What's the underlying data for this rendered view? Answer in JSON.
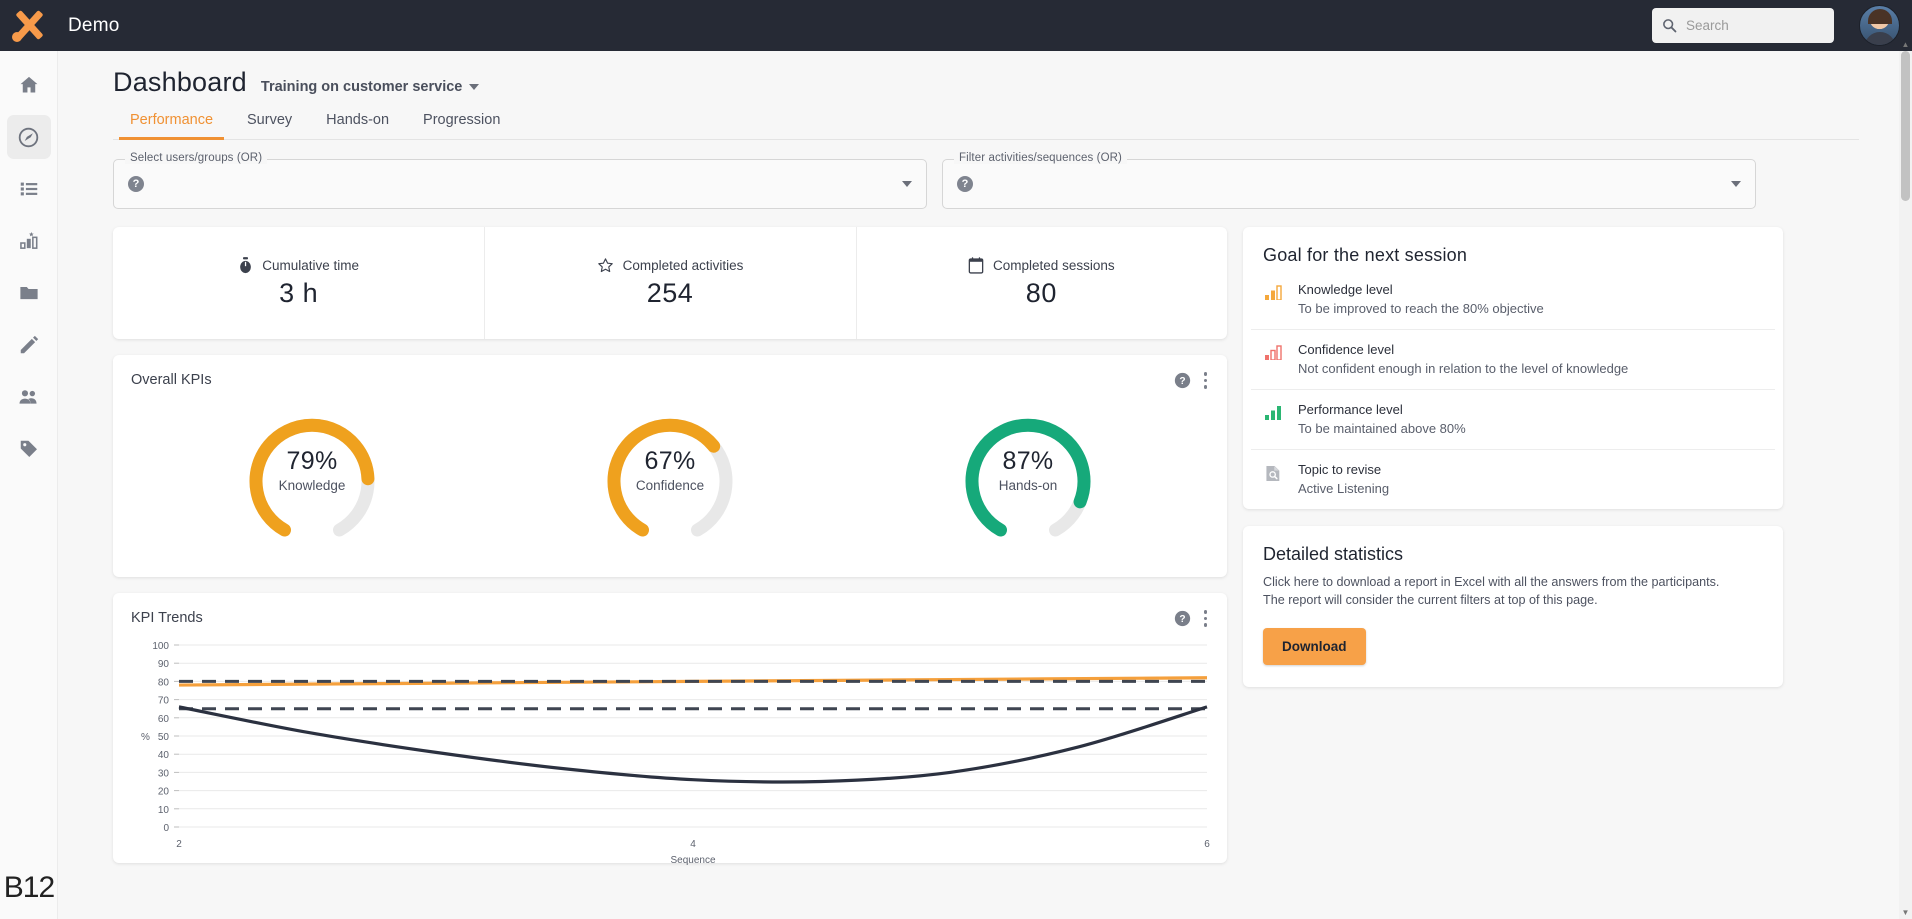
{
  "topbar": {
    "brand": "Demo",
    "search_placeholder": "Search",
    "search_value": "",
    "search_icon": "search-icon",
    "avatar_alt": "user-avatar"
  },
  "sidebar": {
    "items": [
      {
        "icon": "home-icon",
        "name": "home",
        "active": false
      },
      {
        "icon": "speedometer-icon",
        "name": "dashboard",
        "active": true
      },
      {
        "icon": "list-icon",
        "name": "list",
        "active": false
      },
      {
        "icon": "bar-chart-star-icon",
        "name": "results",
        "active": false
      },
      {
        "icon": "folder-icon",
        "name": "library",
        "active": false
      },
      {
        "icon": "pencil-icon",
        "name": "editor",
        "active": false
      },
      {
        "icon": "people-icon",
        "name": "users",
        "active": false
      },
      {
        "icon": "tag-icon",
        "name": "tags",
        "active": false
      }
    ],
    "footer_text": "B12"
  },
  "header": {
    "title": "Dashboard",
    "course": "Training on customer service",
    "tabs": [
      {
        "label": "Performance",
        "active": true
      },
      {
        "label": "Survey",
        "active": false
      },
      {
        "label": "Hands-on",
        "active": false
      },
      {
        "label": "Progression",
        "active": false
      }
    ]
  },
  "filters": [
    {
      "legend": "Select users/groups (OR)",
      "value": "",
      "help": "?"
    },
    {
      "legend": "Filter activities/sequences (OR)",
      "value": "",
      "help": "?"
    }
  ],
  "stats": [
    {
      "icon": "stopwatch-icon",
      "label": "Cumulative time",
      "value": "3 h"
    },
    {
      "icon": "star-icon",
      "label": "Completed activities",
      "value": "254"
    },
    {
      "icon": "calendar-icon",
      "label": "Completed sessions",
      "value": "80"
    }
  ],
  "kpi_card": {
    "title": "Overall KPIs",
    "help_icon": "help-icon",
    "menu_icon": "kebab-menu-icon",
    "gauges": [
      {
        "label": "Knowledge",
        "percent": 79,
        "display": "79%",
        "color": "#EFA11E"
      },
      {
        "label": "Confidence",
        "percent": 67,
        "display": "67%",
        "color": "#EFA11E"
      },
      {
        "label": "Hands-on",
        "percent": 87,
        "display": "87%",
        "color": "#16A97A"
      }
    ],
    "track_color": "#E8E8E8"
  },
  "trends_card": {
    "title": "KPI Trends",
    "help_icon": "help-icon",
    "menu_icon": "kebab-menu-icon"
  },
  "chart_data": {
    "type": "line",
    "title": "KPI Trends",
    "xlabel": "Sequence",
    "ylabel": "%",
    "xlim": [
      2,
      6
    ],
    "ylim": [
      0,
      100
    ],
    "xticks": [
      2,
      4,
      6
    ],
    "yticks": [
      0,
      10,
      20,
      30,
      40,
      50,
      60,
      70,
      80,
      90,
      100
    ],
    "grid": true,
    "legend": "none",
    "series": [
      {
        "name": "KPI trend (orange)",
        "color": "#F5A03C",
        "style": "solid",
        "x": [
          2,
          3,
          4,
          5,
          6
        ],
        "values": [
          78,
          79,
          80,
          81,
          82
        ]
      },
      {
        "name": "Objective 80 (dashed)",
        "color": "#3F4551",
        "style": "dashed",
        "x": [
          2,
          6
        ],
        "values": [
          80,
          80
        ]
      },
      {
        "name": "Threshold 65 (dashed)",
        "color": "#3F4551",
        "style": "dashed",
        "x": [
          2,
          6
        ],
        "values": [
          65,
          65
        ]
      },
      {
        "name": "Performance curve (dark)",
        "color": "#2B3140",
        "style": "solid",
        "x": [
          2,
          2.5,
          3,
          3.5,
          4,
          4.5,
          5,
          5.5,
          6
        ],
        "values": [
          66,
          52,
          41,
          32,
          26,
          25,
          30,
          44,
          66
        ]
      }
    ]
  },
  "goal_panel": {
    "title": "Goal for the next session",
    "items": [
      {
        "icon": "signal-bars-icon",
        "icon_color": "#F5A83C",
        "level": 2,
        "title": "Knowledge level",
        "detail": "To be improved to reach the 80% objective"
      },
      {
        "icon": "signal-bars-icon",
        "icon_color": "#F0736C",
        "level": 1,
        "title": "Confidence level",
        "detail": "Not confident enough in relation to the level of knowledge"
      },
      {
        "icon": "signal-bars-icon",
        "icon_color": "#2BB673",
        "level": 3,
        "title": "Performance level",
        "detail": "To be maintained above 80%"
      },
      {
        "icon": "document-search-icon",
        "icon_color": "#B5B8BE",
        "level": 0,
        "title": "Topic to revise",
        "detail": "Active Listening"
      }
    ]
  },
  "stats_panel": {
    "title": "Detailed statistics",
    "description": "Click here to download a report in Excel with all the answers from the participants. The report will consider the current filters at top of this page.",
    "button": "Download"
  }
}
